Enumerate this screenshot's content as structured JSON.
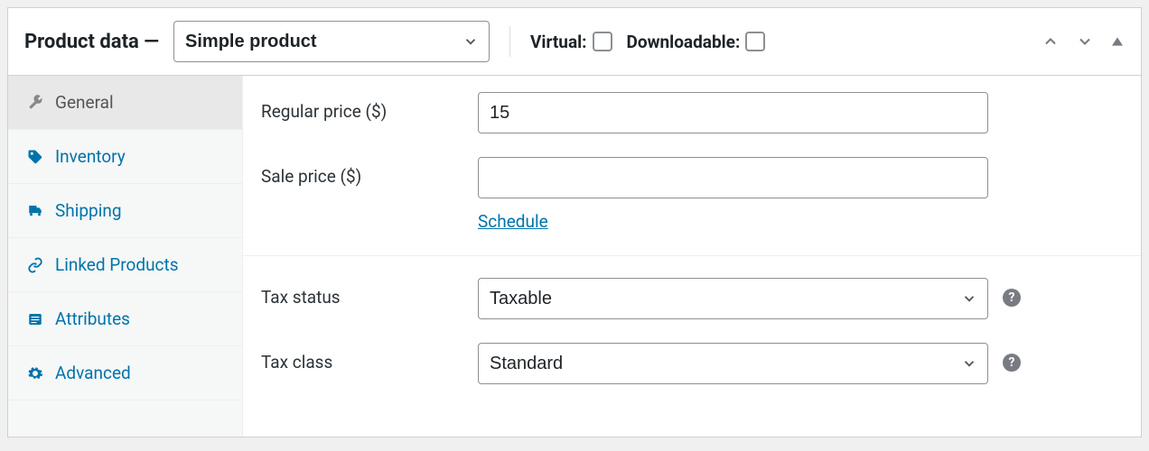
{
  "header": {
    "title": "Product data —",
    "product_type_selected": "Simple product",
    "virtual_label": "Virtual:",
    "downloadable_label": "Downloadable:"
  },
  "tabs": [
    {
      "key": "general",
      "label": "General",
      "icon": "wrench-icon",
      "active": true
    },
    {
      "key": "inventory",
      "label": "Inventory",
      "icon": "tag-icon",
      "active": false
    },
    {
      "key": "shipping",
      "label": "Shipping",
      "icon": "truck-icon",
      "active": false
    },
    {
      "key": "linked",
      "label": "Linked Products",
      "icon": "link-icon",
      "active": false
    },
    {
      "key": "attributes",
      "label": "Attributes",
      "icon": "list-icon",
      "active": false
    },
    {
      "key": "advanced",
      "label": "Advanced",
      "icon": "gear-icon",
      "active": false
    }
  ],
  "fields": {
    "regular_price": {
      "label": "Regular price ($)",
      "value": "15"
    },
    "sale_price": {
      "label": "Sale price ($)",
      "value": "",
      "schedule_link": "Schedule"
    },
    "tax_status": {
      "label": "Tax status",
      "selected": "Taxable"
    },
    "tax_class": {
      "label": "Tax class",
      "selected": "Standard"
    }
  },
  "help_glyph": "?"
}
